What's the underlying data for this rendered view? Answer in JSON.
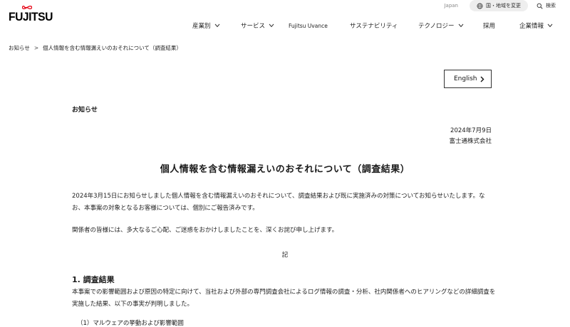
{
  "header": {
    "logo_text": "FUJITSU",
    "language_label": "Japan",
    "region_button": "国・地域を変更",
    "search_label": "検索",
    "nav": [
      {
        "label": "産業別",
        "has_dropdown": true
      },
      {
        "label": "サービス",
        "has_dropdown": true
      },
      {
        "label": "Fujitsu Uvance",
        "has_dropdown": false
      },
      {
        "label": "サステナビリティ",
        "has_dropdown": false
      },
      {
        "label": "テクノロジー",
        "has_dropdown": true
      },
      {
        "label": "採用",
        "has_dropdown": false
      },
      {
        "label": "企業情報",
        "has_dropdown": true
      }
    ]
  },
  "breadcrumb": {
    "home": "お知らせ",
    "separator": ">",
    "current": "個人情報を含む情報漏えいのおそれについて（調査結果）"
  },
  "english_button": "English",
  "section_label": "お知らせ",
  "date": "2024年7月9日",
  "company": "富士通株式会社",
  "title": "個人情報を含む情報漏えいのおそれについて（調査結果）",
  "paragraphs": {
    "intro": "2024年3月15日にお知らせしました個人情報を含む情報漏えいのおそれについて、調査結果および既に実施済みの対策についてお知らせいたします。なお、本事案の対象となるお客様については、個別にご報告済みです。",
    "apology": "関係者の皆様には、多大なるご心配、ご迷惑をおかけしましたことを、深くお詫び申し上げます。",
    "ki": "記",
    "section1_heading": "1. 調査結果",
    "section1_body": "本事案での影響範囲および原因の特定に向けて、当社および外部の専門調査会社によるログ情報の調査・分析、社内関係者へのヒアリングなどの詳細調査を実施した結果、以下の事実が判明しました。",
    "subsection1": "（1）マルウェアの挙動および影響範囲"
  },
  "colors": {
    "brand_red": "#e60012",
    "util_bg": "#eeeeee",
    "text": "#1a1a1a"
  }
}
